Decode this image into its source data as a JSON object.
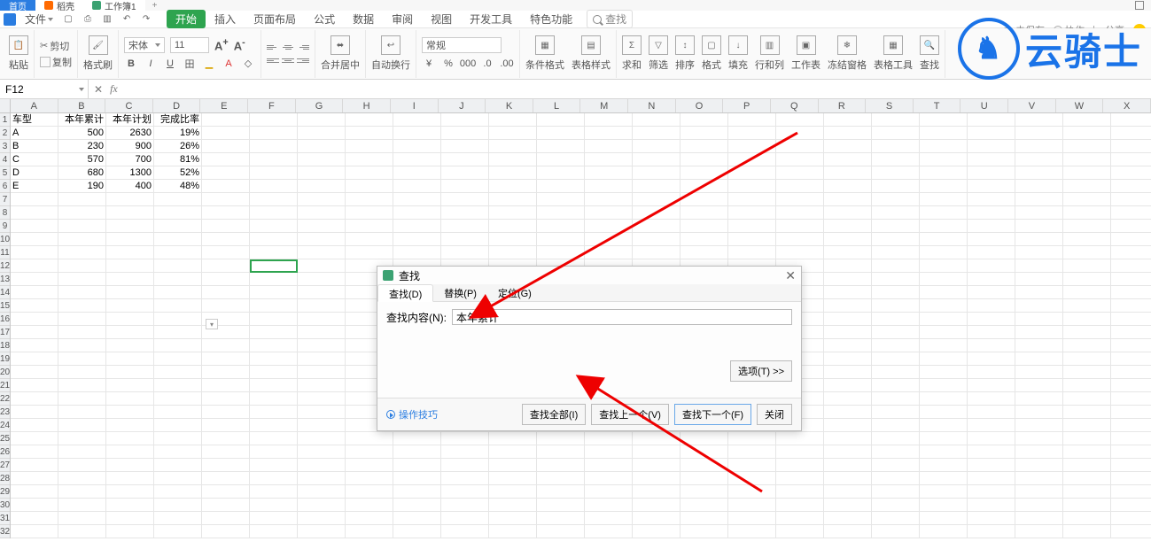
{
  "tabs": {
    "home": "首页",
    "shell": "稻壳",
    "workbook": "工作簿1"
  },
  "top_status": {
    "unsaved": "未保存",
    "collab": "协作",
    "share": "分享"
  },
  "file_menu": "文件",
  "menu": {
    "start": "开始",
    "insert": "插入",
    "page": "页面布局",
    "formula": "公式",
    "data": "数据",
    "review": "审阅",
    "view": "视图",
    "dev": "开发工具",
    "special": "特色功能",
    "search": "查找"
  },
  "ribbon": {
    "paste": "粘贴",
    "cut": "剪切",
    "copy": "复制",
    "format_painter": "格式刷",
    "font_name": "宋体",
    "font_size": "11",
    "merge_center": "合并居中",
    "wrap": "自动换行",
    "number_format": "常规",
    "cond_format": "条件格式",
    "table_style": "表格样式",
    "sum": "求和",
    "filter": "筛选",
    "sort": "排序",
    "format": "格式",
    "fill": "填充",
    "row_col": "行和列",
    "worksheet": "工作表",
    "freeze": "冻结窗格",
    "table_tool": "表格工具",
    "find": "查找"
  },
  "formula": {
    "cell_ref": "F12",
    "fx": "fx"
  },
  "columns": [
    "A",
    "B",
    "C",
    "D",
    "E",
    "F",
    "G",
    "H",
    "I",
    "J",
    "K",
    "L",
    "M",
    "N",
    "O",
    "P",
    "Q",
    "R",
    "S",
    "T",
    "U",
    "V",
    "W",
    "X"
  ],
  "data_rows": [
    {
      "a": "车型",
      "b": "本年累计",
      "c": "本年计划",
      "d": "完成比率"
    },
    {
      "a": "A",
      "b": "500",
      "c": "2630",
      "d": "19%"
    },
    {
      "a": "B",
      "b": "230",
      "c": "900",
      "d": "26%"
    },
    {
      "a": "C",
      "b": "570",
      "c": "700",
      "d": "81%"
    },
    {
      "a": "D",
      "b": "680",
      "c": "1300",
      "d": "52%"
    },
    {
      "a": "E",
      "b": "190",
      "c": "400",
      "d": "48%"
    }
  ],
  "dialog": {
    "title": "查找",
    "tab_find": "查找(D)",
    "tab_replace": "替换(P)",
    "tab_goto": "定位(G)",
    "label_content": "查找内容(N):",
    "input_value": "本年累计",
    "options": "选项(T) >>",
    "tips": "操作技巧",
    "find_all": "查找全部(I)",
    "find_prev": "查找上一个(V)",
    "find_next": "查找下一个(F)",
    "close": "关闭"
  },
  "watermark": "云骑士"
}
